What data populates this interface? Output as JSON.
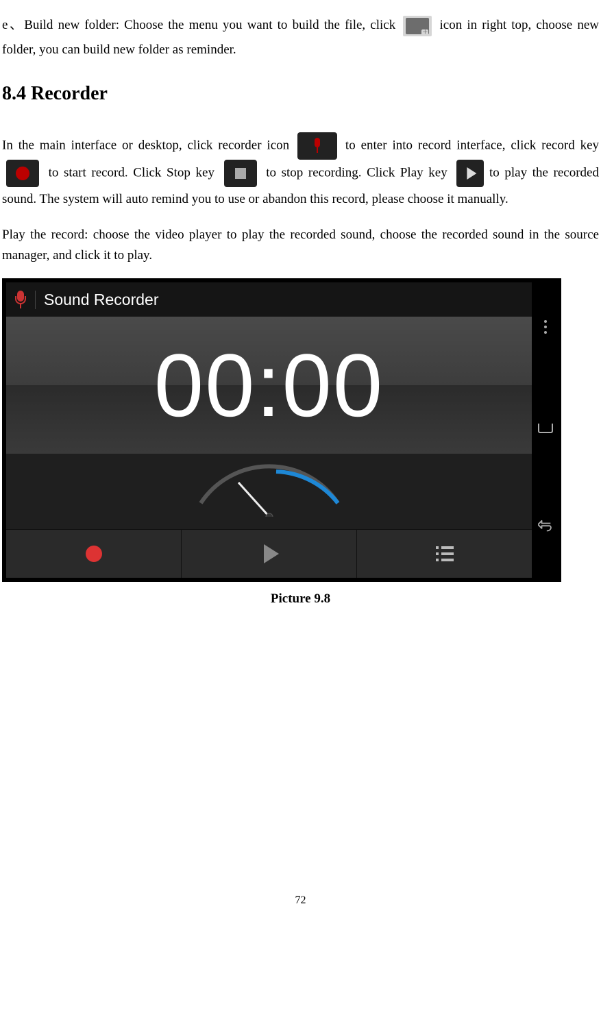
{
  "paragraphs": {
    "e_part1": "e、Build new folder: Choose the menu you want to build the file, click ",
    "e_part2": " icon in right top, choose new folder, you can build new folder as reminder.",
    "p1_part1": "In the main interface or desktop, click recorder icon ",
    "p1_part2": " to enter into record interface, click record key ",
    "p1_part3": " to start record. Click Stop key ",
    "p1_part4": " to stop recording. Click Play key ",
    "p1_part5": " to play the recorded sound. The system will auto remind you to use or abandon this record, please choose it manually.",
    "p2": "Play the record: choose the video player to play the recorded sound, choose the recorded sound in the source manager, and click it to play."
  },
  "heading": "8.4 Recorder",
  "screenshot": {
    "app_title": "Sound Recorder",
    "timer": "00:00"
  },
  "caption": "Picture 9.8",
  "page_number": "72"
}
